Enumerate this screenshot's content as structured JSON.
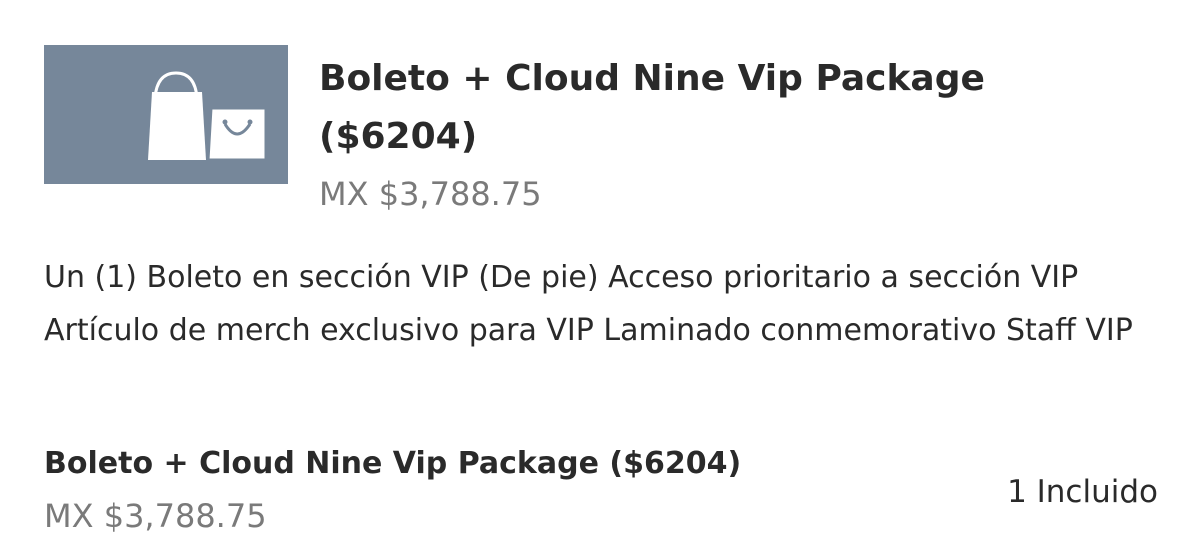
{
  "product": {
    "title": "Boleto + Cloud Nine Vip Package ($6204)",
    "price": "MX $3,788.75",
    "image_icon": "shopping-bags-icon",
    "thumbnail_color": "#76879a"
  },
  "description": "Un (1) Boleto en sección VIP (De pie) Acceso prioritario a sección VIP Artículo de merch exclusivo para VIP Laminado conmemorativo Staff VIP",
  "line_item": {
    "name": "Boleto + Cloud Nine Vip Package ($6204)",
    "price": "MX $3,788.75",
    "quantity_label": "1 Incluido"
  }
}
